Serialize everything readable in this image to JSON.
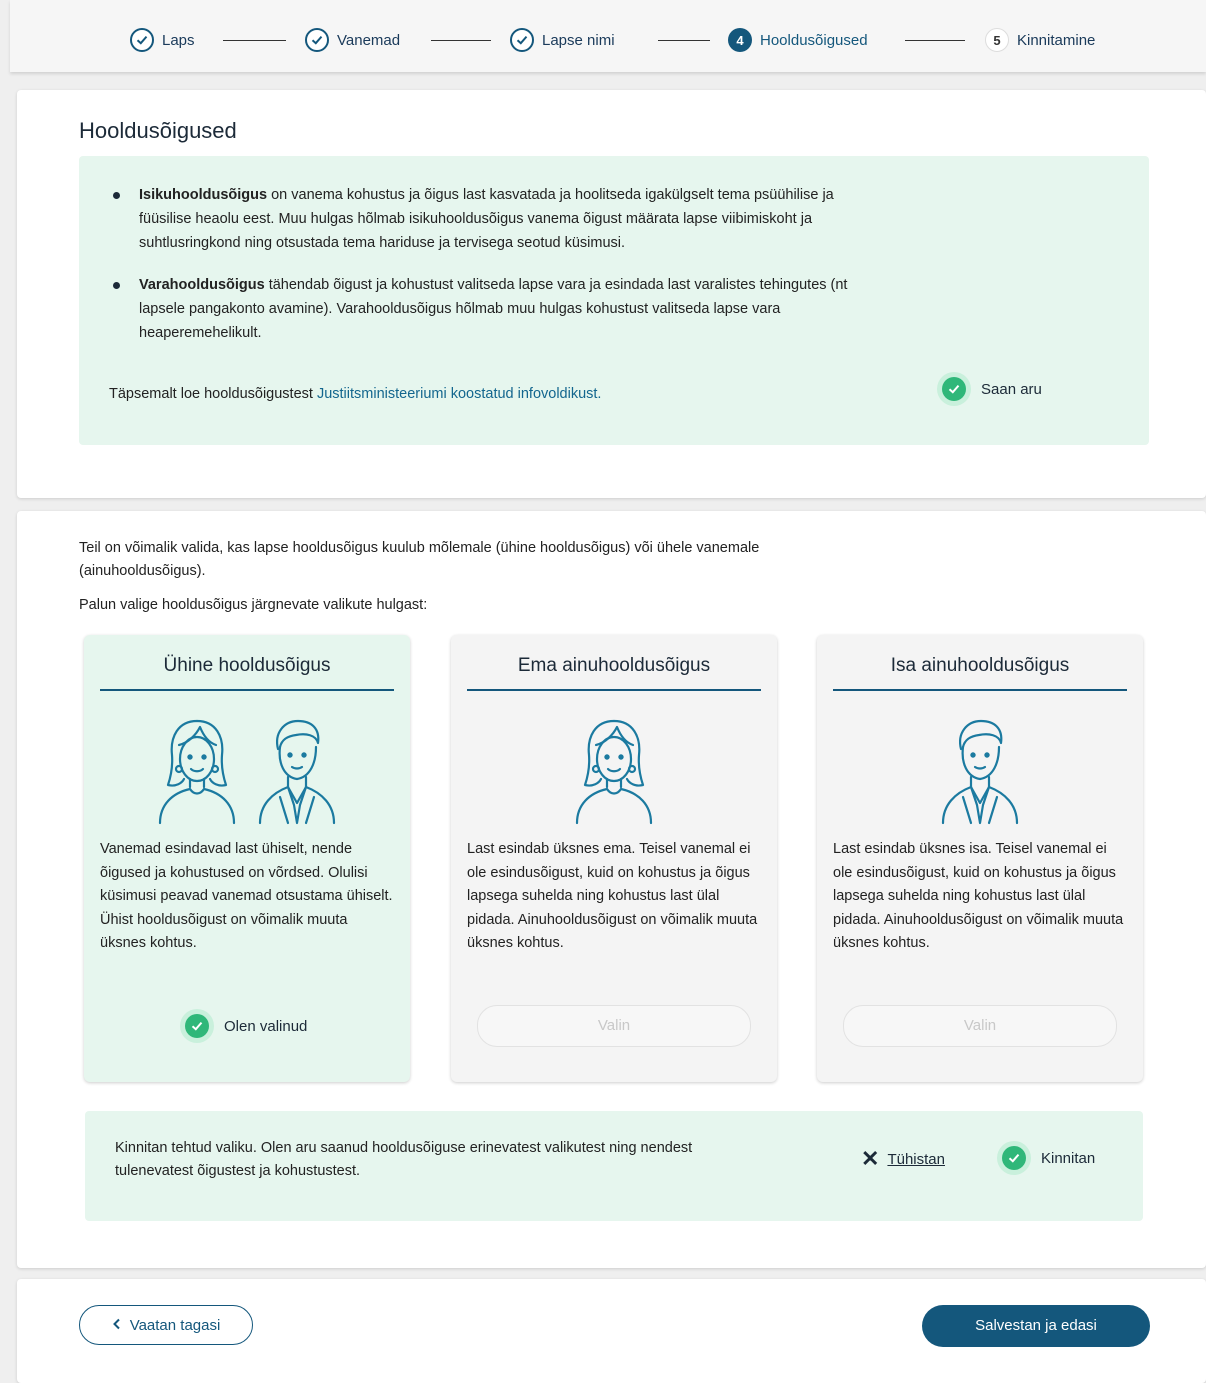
{
  "stepper": {
    "steps": [
      {
        "label": "Laps",
        "state": "done"
      },
      {
        "label": "Vanemad",
        "state": "done"
      },
      {
        "label": "Lapse nimi",
        "state": "done"
      },
      {
        "number": "4",
        "label": "Hooldusõigused",
        "state": "active"
      },
      {
        "number": "5",
        "label": "Kinnitamine",
        "state": "todo"
      }
    ]
  },
  "info_card": {
    "title": "Hooldusõigused",
    "items": [
      {
        "term": "Isikuhooldusõigus",
        "text": " on vanema kohustus ja õigus last kasvatada ja hoolitseda igakülgselt tema psüühilise ja füüsilise heaolu eest. Muu hulgas hõlmab isikuhooldusõigus vanema õigust määrata lapse viibimiskoht ja suhtlusringkond ning otsustada tema hariduse ja tervisega seotud küsimusi."
      },
      {
        "term": "Varahooldusõigus",
        "text": " tähendab õigust ja kohustust valitseda lapse vara ja esindada last varalistes tehingutes (nt lapsele pangakonto avamine). Varahooldusõigus hõlmab muu hulgas kohustust valitseda lapse vara heaperemehelikult."
      }
    ],
    "more_prefix": "Täpsemalt loe hooldusõigustest ",
    "more_link": "Justiitsministeeriumi koostatud infovoldikust.",
    "ok_label": "Saan aru"
  },
  "selection": {
    "intro": "Teil on võimalik valida, kas lapse hooldusõigus kuulub mõlemale (ühine hooldusõigus) või ühele vanemale (ainuhooldusõigus).",
    "prompt": "Palun valige hooldusõigus järgnevate valikute hulgast:",
    "options": [
      {
        "title": "Ühine hooldusõigus",
        "text": "Vanemad esindavad last ühiselt, nende õigused ja kohustused on võrdsed. Olulisi küsimusi peavad vanemad otsustama ühiselt. Ühist hooldusõigust on võimalik muuta üksnes kohtus.",
        "status_label": "Olen valinud",
        "selected": true
      },
      {
        "title": "Ema ainuhooldusõigus",
        "text": "Last esindab üksnes ema. Teisel vanemal ei ole esindusõigust, kuid on kohustus ja õigus lapsega suhelda ning kohustus last ülal pidada. Ainuhooldusõigust on võimalik muuta üksnes kohtus.",
        "button_label": "Valin",
        "selected": false
      },
      {
        "title": "Isa ainuhooldusõigus",
        "text": "Last esindab üksnes isa. Teisel vanemal ei ole esindusõigust, kuid on kohustus ja õigus lapsega suhelda ning kohustus last ülal pidada. Ainuhooldusõigust on võimalik muuta üksnes kohtus.",
        "button_label": "Valin",
        "selected": false
      }
    ],
    "confirm_text": "Kinnitan tehtud valiku. Olen aru saanud hooldusõiguse erinevatest valikutest ning nendest tulenevatest õigustest ja kohustustest.",
    "cancel_label": "Tühistan",
    "confirm_label": "Kinnitan"
  },
  "footer": {
    "back_label": "Vaatan tagasi",
    "next_label": "Salvestan ja edasi"
  },
  "colors": {
    "primary": "#14577c",
    "success": "#2fb779",
    "info_bg": "#e6f6ee"
  }
}
